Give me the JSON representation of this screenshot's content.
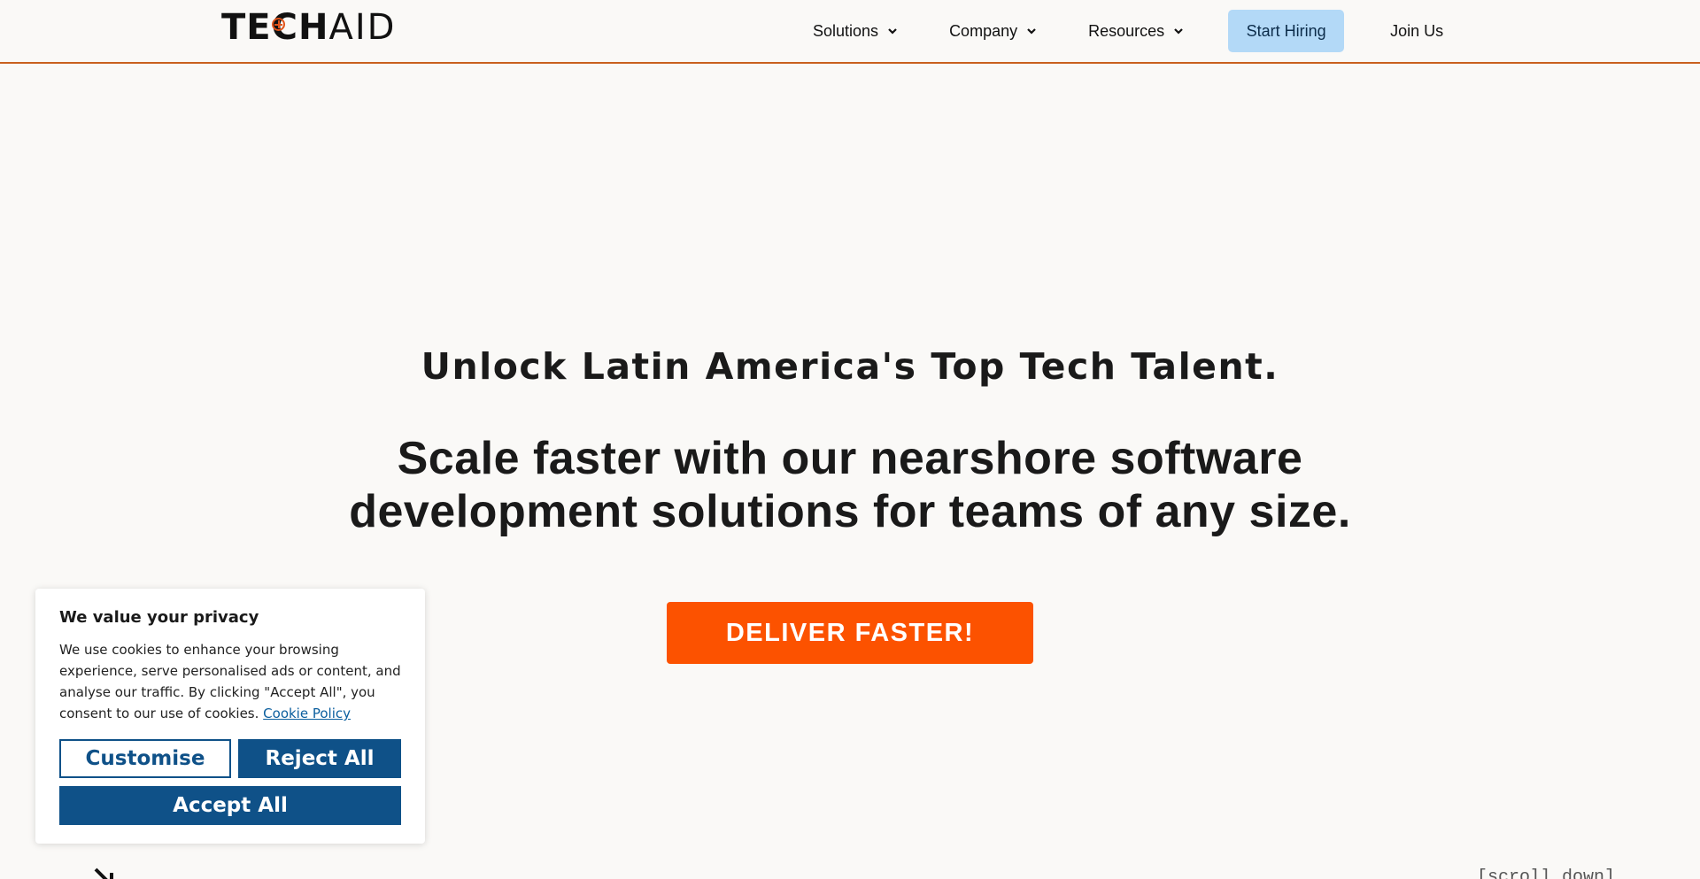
{
  "header": {
    "logo": {
      "bold": "TECH",
      "light": "AID"
    },
    "nav": {
      "solutions": "Solutions",
      "company": "Company",
      "resources": "Resources",
      "start_hiring": "Start Hiring",
      "join_us": "Join Us"
    }
  },
  "hero": {
    "subtitle": "Unlock Latin America's Top Tech Talent.",
    "title": "Scale faster with our nearshore software development solutions for teams of any size.",
    "cta": "DELIVER FASTER!"
  },
  "cookie_banner": {
    "title": "We value your privacy",
    "body": "We use cookies to enhance your browsing experience, serve personalised ads or content, and analyse our traffic. By clicking \"Accept All\", you consent to our use of cookies.",
    "policy_link": "Cookie Policy",
    "customise": "Customise",
    "reject_all": "Reject All",
    "accept_all": "Accept All"
  },
  "footer_hint": {
    "scroll": "[scroll down]"
  },
  "colors": {
    "accent": "#fc5200",
    "header_rule": "#c9601e",
    "hire_button": "#b3d9f7",
    "cookie_primary": "#0f5188"
  },
  "icons": {
    "nav_chevron": "chevron-down-icon",
    "scroll_arrow": "arrow-down-right-icon"
  }
}
